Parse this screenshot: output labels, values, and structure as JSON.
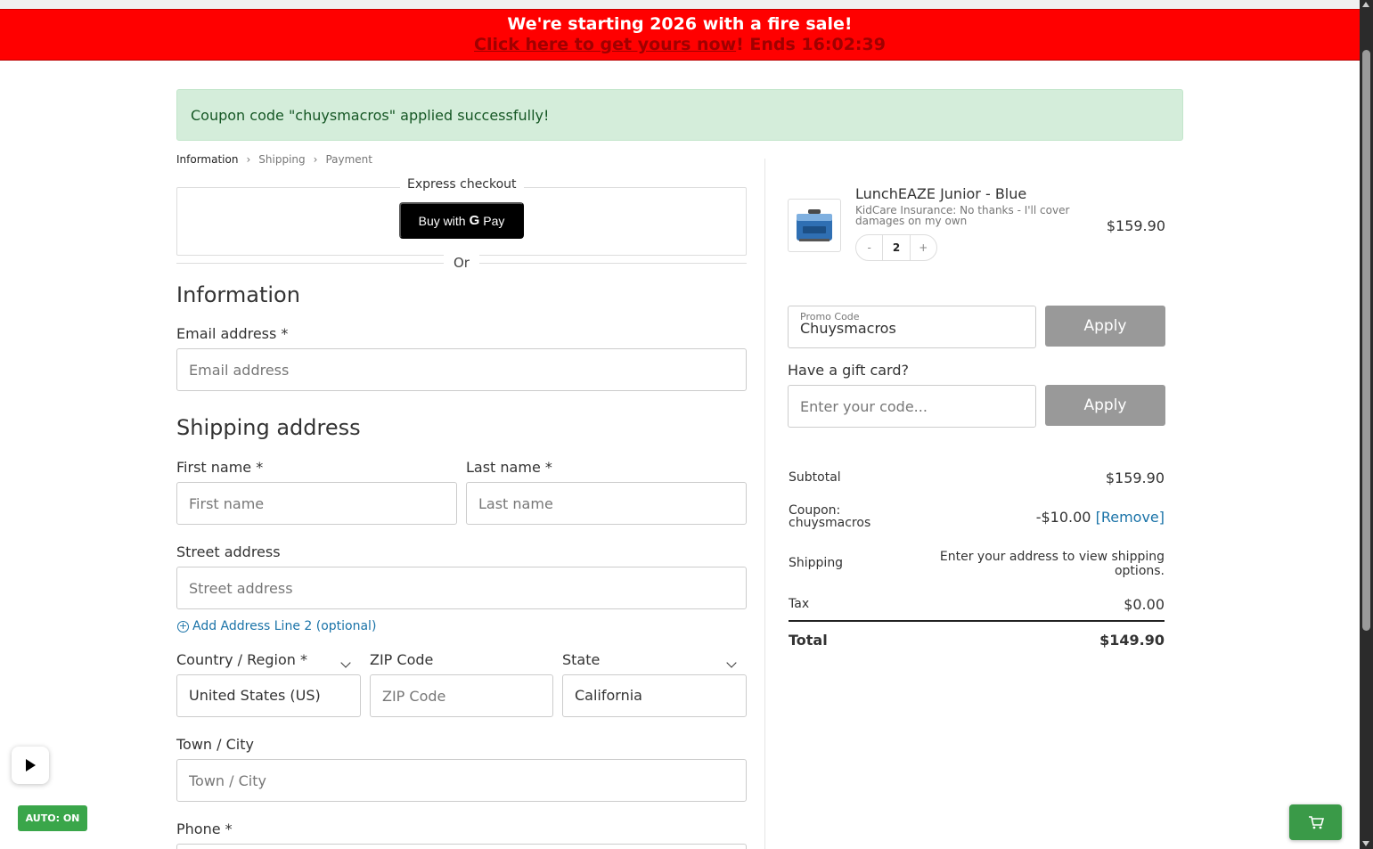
{
  "banner": {
    "line1": "We're starting 2026 with a fire sale!",
    "link": "Click here to get yours now",
    "ends": "! Ends 16:02:39"
  },
  "coupon_notice": "Coupon code \"chuysmacros\" applied successfully!",
  "breadcrumb": {
    "items": [
      "Information",
      "Shipping",
      "Payment"
    ],
    "separator": ">"
  },
  "express": {
    "label": "Express checkout",
    "gpay_prefix": "Buy with",
    "gpay_g": "G",
    "gpay_suffix": "Pay",
    "or": "Or"
  },
  "information": {
    "heading": "Information",
    "email_label": "Email address *",
    "email_placeholder": "Email address"
  },
  "shipping": {
    "heading": "Shipping address",
    "first_label": "First name *",
    "first_placeholder": "First name",
    "last_label": "Last name *",
    "last_placeholder": "Last name",
    "street_label": "Street address",
    "street_placeholder": "Street address",
    "add_line2": "Add Address Line 2 (optional)",
    "country_label": "Country / Region *",
    "country_value": "United States (US)",
    "zip_label": "ZIP Code",
    "zip_placeholder": "ZIP Code",
    "state_label": "State",
    "state_value": "California",
    "city_label": "Town / City",
    "city_placeholder": "Town / City",
    "phone_label": "Phone *"
  },
  "cart": {
    "product_name": "LunchEAZE Junior - Blue",
    "product_sub": "KidCare Insurance: No thanks - I'll cover damages on my own",
    "quantity": "2",
    "qty_minus": "-",
    "qty_plus": "+",
    "price": "$159.90"
  },
  "promo": {
    "label": "Promo Code",
    "value": "Chuysmacros",
    "apply": "Apply",
    "gift_label": "Have a gift card?",
    "gift_placeholder": "Enter your code...",
    "gift_apply": "Apply"
  },
  "summary": {
    "subtotal_label": "Subtotal",
    "subtotal_value": "$159.90",
    "coupon_label": "Coupon: chuysmacros",
    "coupon_value": "-$10.00",
    "coupon_remove": "[Remove]",
    "shipping_label": "Shipping",
    "shipping_value": "Enter your address to view shipping options.",
    "tax_label": "Tax",
    "tax_value": "$0.00",
    "total_label": "Total",
    "total_value": "$149.90"
  },
  "widgets": {
    "auto_label": "AUTO: ON"
  },
  "colors": {
    "banner_bg": "#ff0000",
    "coupon_bg": "#d4edda",
    "apply_bg": "#999999",
    "link": "#1a73a8",
    "auto_bg": "#3aa64a"
  }
}
